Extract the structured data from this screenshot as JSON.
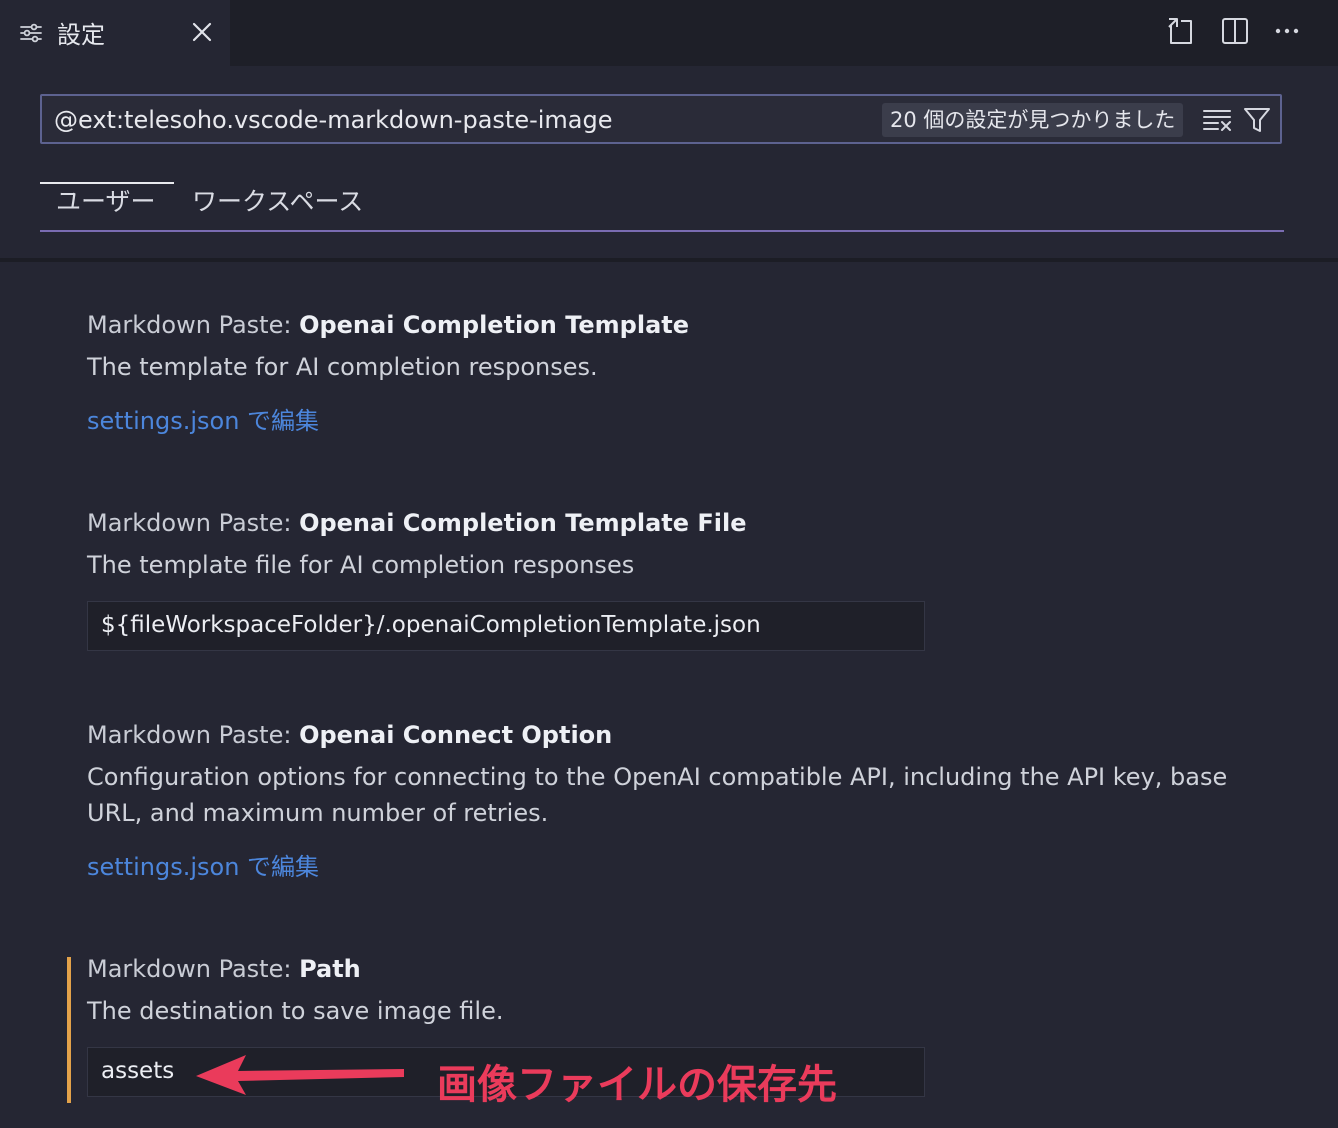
{
  "tab": {
    "title": "設定",
    "icon": "settings-sliders-icon",
    "close_icon": "close-icon"
  },
  "toolbar": {
    "icons": [
      "open-json-icon",
      "split-editor-icon",
      "more-actions-icon"
    ]
  },
  "search": {
    "query": "@ext:telesoho.vscode-markdown-paste-image",
    "count": "20 個の設定が見つかりました",
    "clear_icon": "clear-filter-icon",
    "filter_icon": "filter-icon"
  },
  "scope_tabs": [
    {
      "label": "ユーザー",
      "active": true
    },
    {
      "label": "ワークスペース",
      "active": false
    }
  ],
  "settings": [
    {
      "category": "Markdown Paste: ",
      "name": "Openai Completion Template",
      "description": "The template for AI completion responses.",
      "link": "settings.json で編集"
    },
    {
      "category": "Markdown Paste: ",
      "name": "Openai Completion Template File",
      "description": "The template file for AI completion responses",
      "value": "${fileWorkspaceFolder}/.openaiCompletionTemplate.json"
    },
    {
      "category": "Markdown Paste: ",
      "name": "Openai Connect Option",
      "description": "Configuration options for connecting to the OpenAI compatible API, including the API key, base URL, and maximum number of retries.",
      "link": "settings.json で編集"
    },
    {
      "category": "Markdown Paste: ",
      "name": "Path",
      "description": "The destination to save image file.",
      "value": "assets"
    }
  ],
  "annotation": {
    "text": "画像ファイルの保存先",
    "color": "#ea3b5b"
  },
  "colors": {
    "link": "#4c86dc",
    "modified": "#e3a24a",
    "tab_underline": "#8a79c9"
  }
}
